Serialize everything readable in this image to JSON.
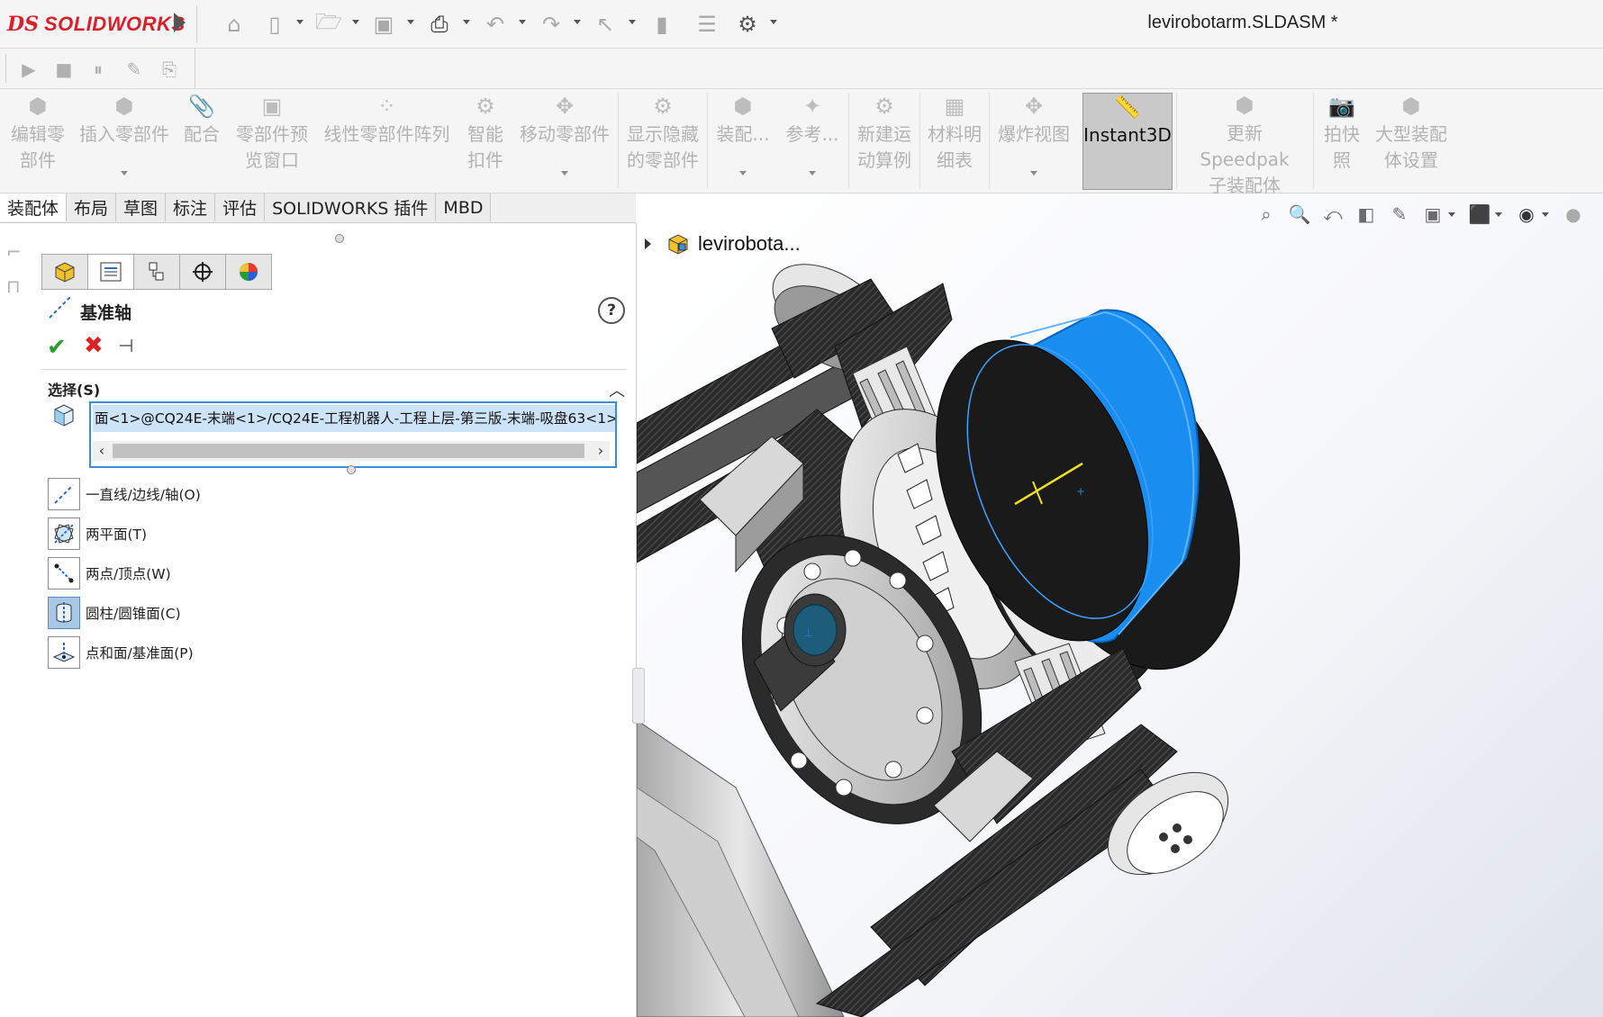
{
  "app": {
    "brand_ds": "𝟹S",
    "brand_name": "SOLIDWORKS",
    "document_title": "levirobotarm.SLDASM *"
  },
  "command_manager": [
    {
      "label": "编辑零\n部件",
      "icon": "edit-component-icon"
    },
    {
      "label": "插入零部件",
      "icon": "insert-component-icon",
      "dropdown": true
    },
    {
      "label": "配合",
      "icon": "mate-icon"
    },
    {
      "label": "零部件预\n览窗口",
      "icon": "component-preview-icon"
    },
    {
      "label": "线性零部件阵列",
      "icon": "linear-pattern-icon"
    },
    {
      "label": "智能\n扣件",
      "icon": "smart-fasteners-icon"
    },
    {
      "label": "移动零部件",
      "icon": "move-component-icon",
      "dropdown": true
    },
    {
      "label": "显示隐藏\n的零部件",
      "icon": "show-hidden-icon"
    },
    {
      "label": "装配...",
      "icon": "assembly-features-icon",
      "dropdown": true
    },
    {
      "label": "参考...",
      "icon": "reference-geometry-icon",
      "dropdown": true
    },
    {
      "label": "新建运\n动算例",
      "icon": "new-motion-study-icon"
    },
    {
      "label": "材料明\n细表",
      "icon": "bill-of-materials-icon"
    },
    {
      "label": "爆炸视图",
      "icon": "exploded-view-icon",
      "dropdown": true
    },
    {
      "label": "Instant3D",
      "icon": "instant3d-icon",
      "active": true
    },
    {
      "label": "更新 Speedpak\n子装配体",
      "icon": "speedpak-icon"
    },
    {
      "label": "拍快\n照",
      "icon": "snapshot-icon"
    },
    {
      "label": "大型装配\n体设置",
      "icon": "large-assembly-icon"
    }
  ],
  "tabs": [
    "装配体",
    "布局",
    "草图",
    "标注",
    "评估",
    "SOLIDWORKS 插件",
    "MBD"
  ],
  "property_manager": {
    "title": "基准轴",
    "help": "?",
    "section_label": "选择(S)",
    "selection_value": "面<1>@CQ24E-末端<1>/CQ24E-工程机器人-工程上层-第三版-末端-吸盘63<1>",
    "options": [
      {
        "label": "一直线/边线/轴(O)",
        "icon": "line-edge-axis-icon"
      },
      {
        "label": "两平面(T)",
        "icon": "two-planes-icon"
      },
      {
        "label": "两点/顶点(W)",
        "icon": "two-points-icon"
      },
      {
        "label": "圆柱/圆锥面(C)",
        "icon": "cylindrical-face-icon",
        "active": true
      },
      {
        "label": "点和面/基准面(P)",
        "icon": "point-and-face-icon"
      }
    ]
  },
  "feature_tree": {
    "root_label": "levirobota..."
  },
  "colors": {
    "accent_blue": "#1e90ff",
    "brand_red": "#d81f2a",
    "selected_face": "#1a8df0"
  }
}
